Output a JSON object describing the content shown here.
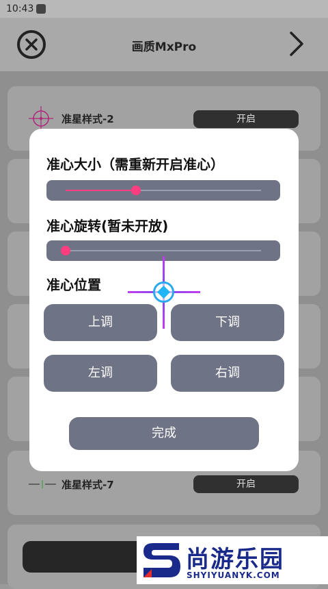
{
  "status": {
    "time": "10:43"
  },
  "header": {
    "title": "画质MxPro",
    "close_icon": "close-circle-icon",
    "next_icon": "chevron-right-icon"
  },
  "background": {
    "rows": [
      {
        "label": "准星样式-2",
        "toggle": "开启"
      },
      {
        "label": "准星样式-7",
        "toggle": "开启"
      }
    ]
  },
  "modal": {
    "size_label": "准心大小（需重新开启准心）",
    "size_value": 0.36,
    "rotate_label": "准心旋转(暂未开放)",
    "rotate_value": 0.0,
    "position_label": "准心位置",
    "buttons": {
      "up": "上调",
      "down": "下调",
      "left": "左调",
      "right": "右调"
    },
    "done": "完成"
  },
  "watermark": {
    "main": "尚游乐园",
    "sub": "SHYIYUANYK.COM"
  },
  "colors": {
    "accent": "#ff3d7f",
    "button": "#6e7385",
    "crosshair": "#c23cf0"
  }
}
